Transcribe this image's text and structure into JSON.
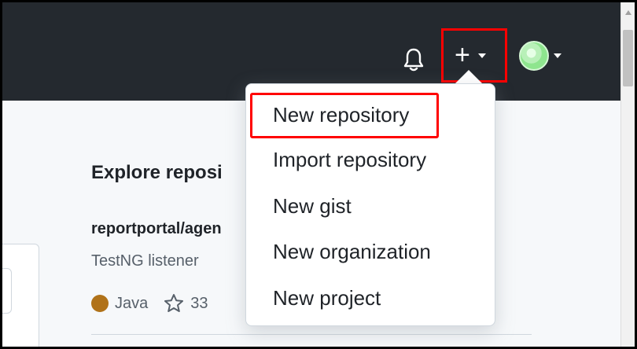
{
  "header": {
    "notifications_icon": "bell-icon",
    "create_toggle": {
      "icon": "plus-icon",
      "glyph": "+",
      "caret_icon": "caret-down-icon"
    },
    "avatar_toggle": {
      "caret_icon": "caret-down-icon"
    }
  },
  "content": {
    "explore_title": "Explore reposi",
    "repository": {
      "name": "reportportal/agen",
      "description": "TestNG listener",
      "language": "Java",
      "language_color": "#b07219",
      "stars": "33"
    }
  },
  "dropdown": {
    "items": [
      {
        "label": "New repository",
        "highlighted": true
      },
      {
        "label": "Import repository"
      },
      {
        "label": "New gist"
      },
      {
        "label": "New organization"
      },
      {
        "label": "New project"
      }
    ]
  },
  "colors": {
    "header_bg": "#24292f",
    "highlight": "#ff0000",
    "page_bg": "#f6f8fa"
  }
}
